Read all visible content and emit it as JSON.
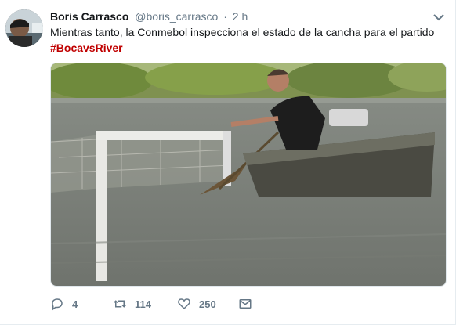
{
  "tweet": {
    "author_name": "Boris Carrasco",
    "handle": "@boris_carrasco",
    "separator": "·",
    "time": "2 h",
    "text": "Mientras tanto, la Conmebol inspecciona el estado de la cancha para el partido",
    "hashtag": "#BocavsRiver"
  },
  "actions": {
    "reply_count": "4",
    "retweet_count": "114",
    "like_count": "250"
  },
  "icons": [
    "chevron-down-icon",
    "reply-icon",
    "retweet-icon",
    "heart-icon",
    "direct-message-icon"
  ],
  "colors": {
    "hashtag": "#c00000",
    "muted": "#657786"
  }
}
